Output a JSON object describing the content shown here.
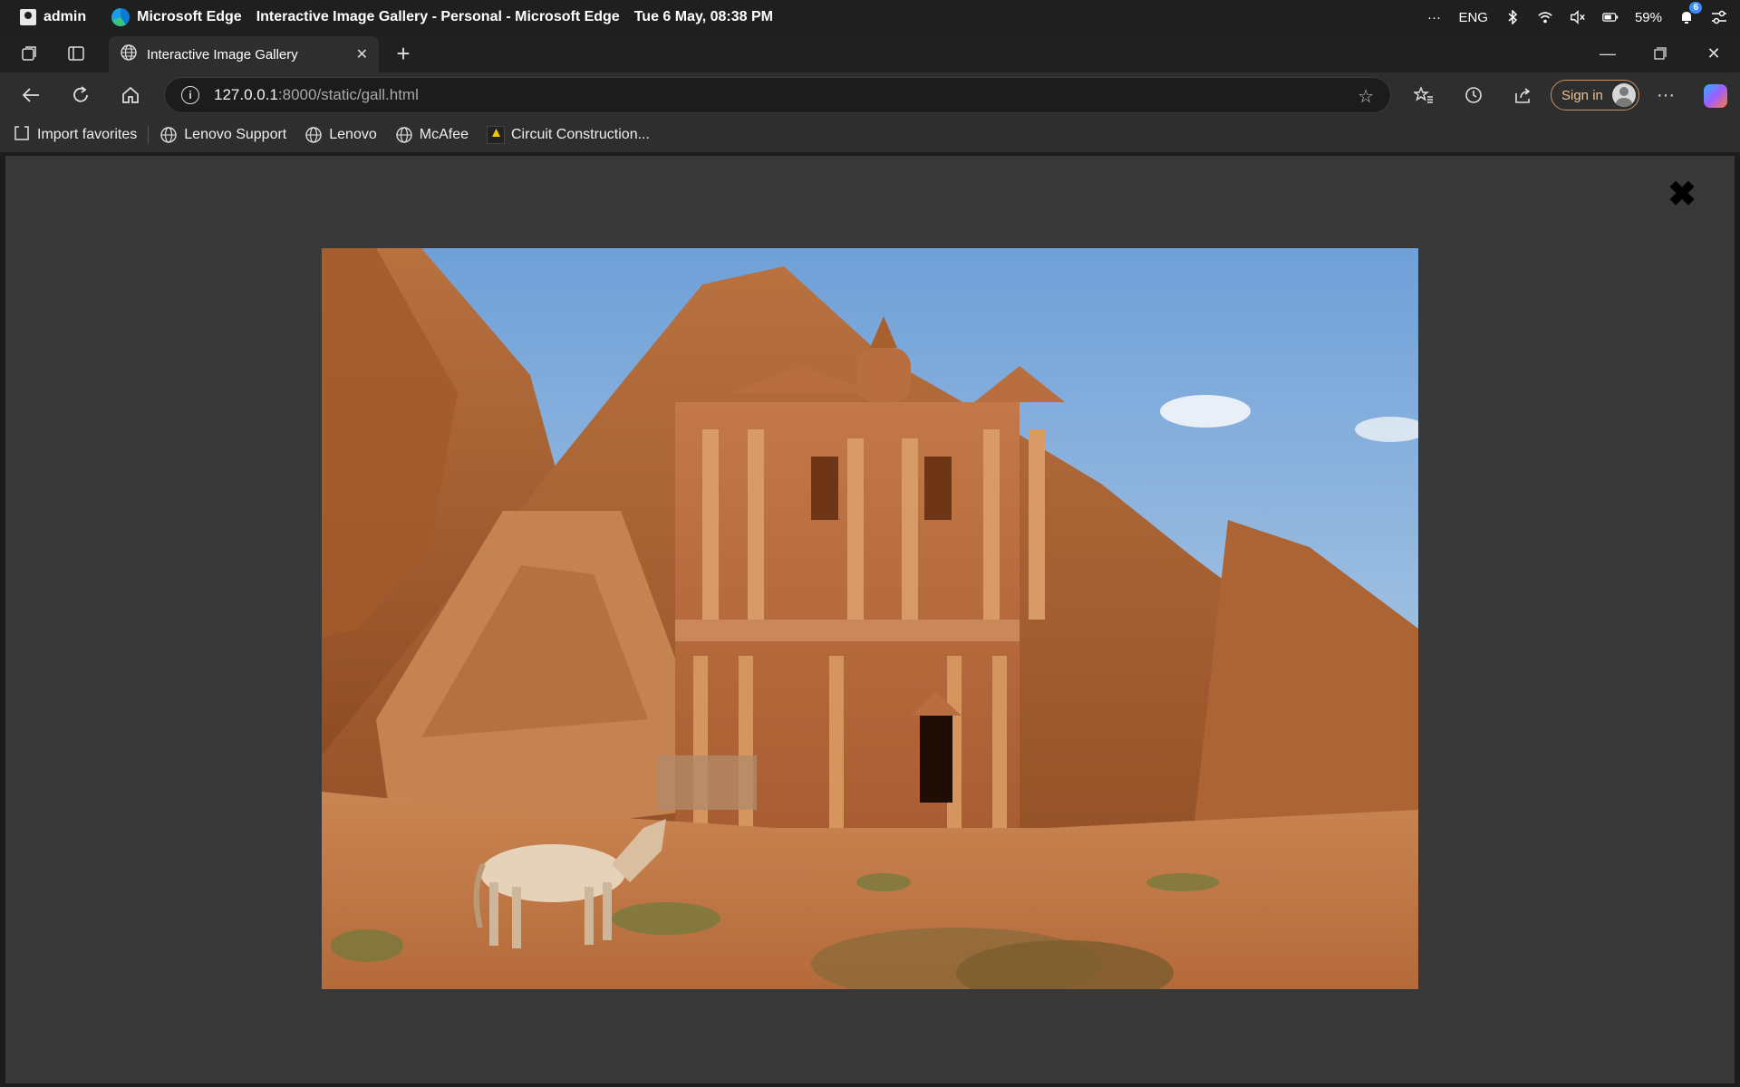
{
  "os": {
    "user": "admin",
    "app_name": "Microsoft Edge",
    "window_title": "Interactive Image Gallery - Personal - Microsoft Edge",
    "datetime": "Tue 6 May, 08:38 PM",
    "language": "ENG",
    "battery": "59%",
    "notification_count": "6",
    "more_label": "···"
  },
  "tab": {
    "title": "Interactive Image Gallery"
  },
  "address": {
    "host": "127.0.0.1",
    "path": ":8000/static/gall.html"
  },
  "toolbar": {
    "signin_label": "Sign in"
  },
  "favorites": {
    "import_label": "Import favorites",
    "items": [
      "Lenovo Support",
      "Lenovo",
      "McAfee",
      "Circuit Construction..."
    ]
  },
  "gallery": {
    "close_glyph": "✖"
  },
  "colors": {
    "page_bg": "#383838",
    "chrome_dark": "#1f1f1f",
    "chrome_mid": "#2e2e2e",
    "signin_accent": "#c89060"
  }
}
